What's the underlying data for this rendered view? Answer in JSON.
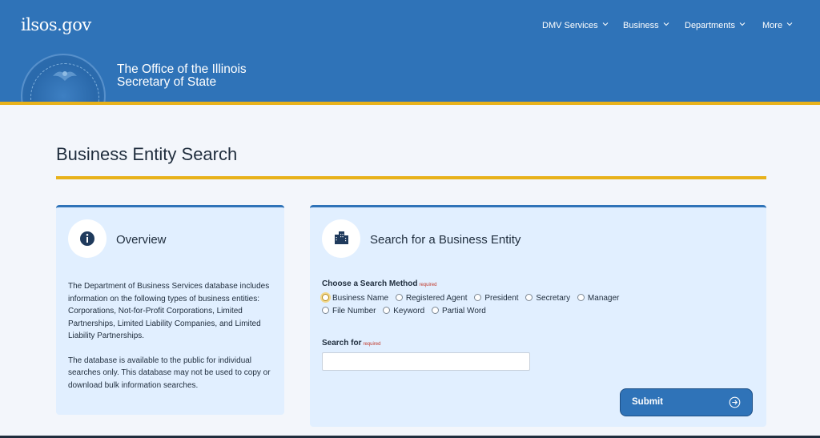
{
  "header": {
    "logo": "ilsos.gov",
    "office_title_line1": "The Office of the Illinois",
    "office_title_line2": "Secretary of State",
    "nav": [
      {
        "label": "DMV Services"
      },
      {
        "label": "Business"
      },
      {
        "label": "Departments"
      },
      {
        "label": "More"
      }
    ]
  },
  "page": {
    "title": "Business Entity Search"
  },
  "overview": {
    "heading": "Overview",
    "paragraph1": "The Department of Business Services database includes information on the following types of business entities: Corporations, Not-for-Profit Corporations, Limited Partnerships, Limited Liability Companies, and Limited Liability Partnerships.",
    "paragraph2": "The database is available to the public for individual searches only. This database may not be used to copy or download bulk information searches."
  },
  "search": {
    "heading": "Search for a Business Entity",
    "method_label": "Choose a Search Method",
    "required_text": "required",
    "methods_row1": [
      "Business Name",
      "Registered Agent",
      "President",
      "Secretary",
      "Manager"
    ],
    "methods_row2": [
      "File Number",
      "Keyword",
      "Partial Word"
    ],
    "selected_method": "Business Name",
    "search_for_label": "Search for",
    "search_value": "",
    "submit_label": "Submit"
  },
  "colors": {
    "header_blue": "#2f73b8",
    "accent_gold": "#e8b21b",
    "card_bg": "#e1efff",
    "icon_dark": "#1f3a5c"
  },
  "icons": {
    "nav_chevron": "chevron-down-icon",
    "overview": "info-icon",
    "search": "building-icon",
    "submit": "arrow-right-circle-icon"
  }
}
